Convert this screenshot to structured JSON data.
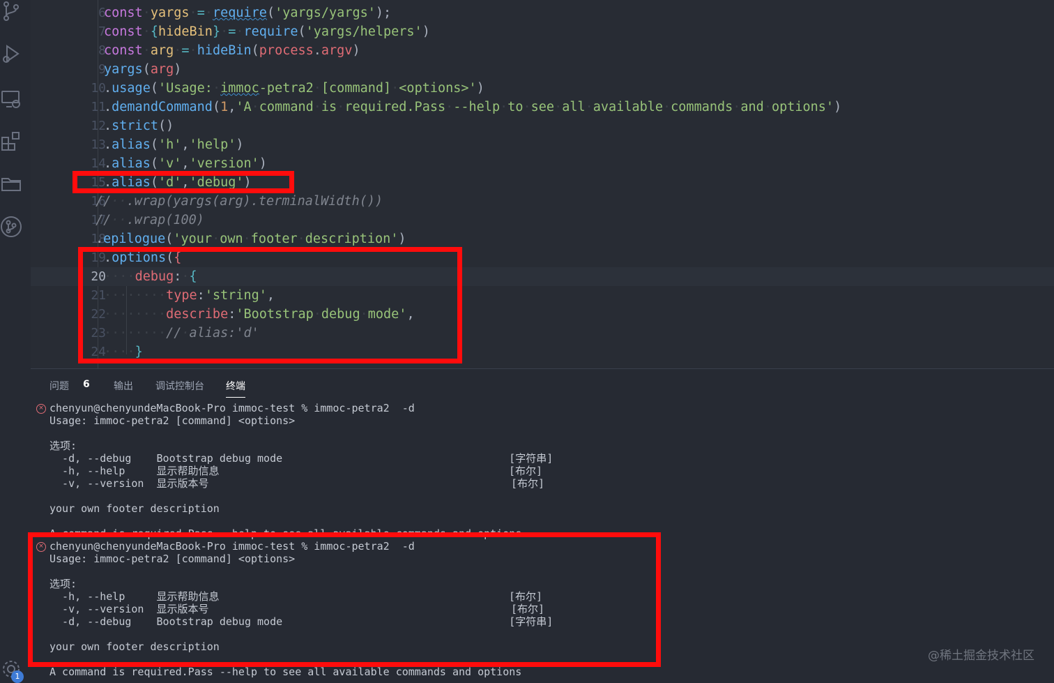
{
  "editor": {
    "current_line": "20",
    "lines": [
      {
        "num": "6",
        "text": "const yargs = require('yargs/yargs');"
      },
      {
        "num": "7",
        "text": "const {hideBin} = require('yargs/helpers')"
      },
      {
        "num": "8",
        "text": "const arg = hideBin(process.argv)"
      },
      {
        "num": "9",
        "text": "yargs(arg)"
      },
      {
        "num": "10",
        "text": ".usage('Usage: immoc-petra2 [command] <options>')"
      },
      {
        "num": "11",
        "text": ".demandCommand(1,'A command is required.Pass --help to see all available commands and options')"
      },
      {
        "num": "12",
        "text": ".strict()"
      },
      {
        "num": "13",
        "text": ".alias('h','help')"
      },
      {
        "num": "14",
        "text": ".alias('v','version')"
      },
      {
        "num": "15",
        "text": ".alias('d','debug')"
      },
      {
        "num": "16",
        "text": "//  .wrap(yargs(arg).terminalWidth())"
      },
      {
        "num": "17",
        "text": "//  .wrap(100)"
      },
      {
        "num": "18",
        "text": ".epilogue('your own footer description')"
      },
      {
        "num": "19",
        "text": ".options({"
      },
      {
        "num": "20",
        "text": "debug: {"
      },
      {
        "num": "21",
        "text": "type:'string',"
      },
      {
        "num": "22",
        "text": "describe:'Bootstrap debug mode',"
      },
      {
        "num": "23",
        "text": "// alias:'d'"
      },
      {
        "num": "24",
        "text": "}"
      }
    ]
  },
  "panel": {
    "tabs": {
      "problems": "问题",
      "problems_count": "6",
      "output": "输出",
      "debug_console": "调试控制台",
      "terminal": "终端"
    },
    "terminal_lines": [
      "chenyun@chenyundeMacBook-Pro immoc-test % immoc-petra2  -d",
      "Usage: immoc-petra2 [command] <options>",
      "",
      "选项:",
      "  -d, --debug    Bootstrap debug mode                                    [字符串]",
      "  -h, --help     显示帮助信息                                              [布尔]",
      "  -v, --version  显示版本号                                                [布尔]",
      "",
      "your own footer description",
      "",
      "A command is required.Pass --help to see all available commands and options",
      "chenyun@chenyundeMacBook-Pro immoc-test % immoc-petra2  -d",
      "Usage: immoc-petra2 [command] <options>",
      "",
      "选项:",
      "  -h, --help     显示帮助信息                                              [布尔]",
      "  -v, --version  显示版本号                                                [布尔]",
      "  -d, --debug    Bootstrap debug mode                                    [字符串]",
      "",
      "your own footer description",
      "",
      "A command is required.Pass --help to see all available commands and options"
    ]
  },
  "status": {
    "gear_badge": "1"
  },
  "watermark": "@稀土掘金技术社区",
  "colors": {
    "highlight_box": "#ff0c0c",
    "editor_bg": "#282c34",
    "panel_bg": "#262a33"
  }
}
